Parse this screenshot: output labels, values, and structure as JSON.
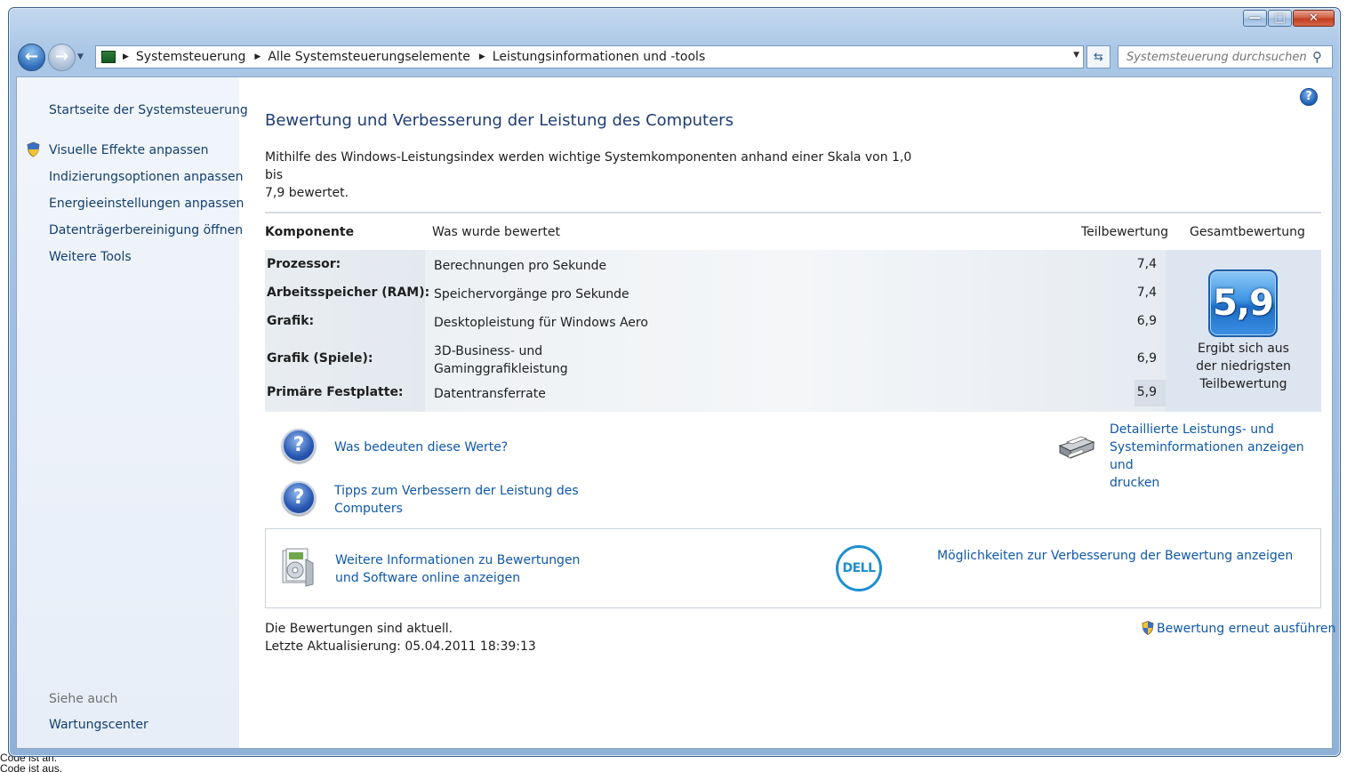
{
  "window": {
    "caption_buttons": [
      "minimize",
      "maximize",
      "close"
    ]
  },
  "nav": {
    "breadcrumbs": [
      "Systemsteuerung",
      "Alle Systemsteuerungselemente",
      "Leistungsinformationen und -tools"
    ],
    "search_placeholder": "Systemsteuerung durchsuchen"
  },
  "sidebar": {
    "items": [
      {
        "label": "Startseite der Systemsteuerung"
      },
      {
        "label": "Visuelle Effekte anpassen"
      },
      {
        "label": "Indizierungsoptionen anpassen"
      },
      {
        "label": "Energieeinstellungen anpassen"
      },
      {
        "label": "Datenträgerbereinigung öffnen"
      },
      {
        "label": "Weitere Tools"
      }
    ],
    "see_also_label": "Siehe auch",
    "see_also_items": [
      {
        "label": "Wartungscenter"
      }
    ]
  },
  "main": {
    "title": "Bewertung und Verbesserung der Leistung des Computers",
    "intro_line1": "Mithilfe des Windows-Leistungsindex werden wichtige Systemkomponenten anhand einer Skala von 1,0 bis",
    "intro_line2": "7,9 bewertet.",
    "table": {
      "headers": {
        "component": "Komponente",
        "rated": "Was wurde bewertet",
        "subscore": "Teilbewertung",
        "basescore": "Gesamtbewertung"
      },
      "rows": [
        {
          "component": "Prozessor:",
          "what": "Berechnungen pro Sekunde",
          "what2": "",
          "score": "7,4"
        },
        {
          "component": "Arbeitsspeicher (RAM):",
          "what": "Speichervorgänge pro Sekunde",
          "what2": "",
          "score": "7,4"
        },
        {
          "component": "Grafik:",
          "what": "Desktopleistung für Windows Aero",
          "what2": "",
          "score": "6,9"
        },
        {
          "component": "Grafik (Spiele):",
          "what": "3D-Business- und",
          "what2": "Gaminggrafikleistung",
          "score": "6,9"
        },
        {
          "component": "Primäre Festplatte:",
          "what": "Datentransferrate",
          "what2": "",
          "score": "5,9"
        }
      ],
      "base_score": "5,9",
      "base_note_line1": "Ergibt sich aus",
      "base_note_line2": "der niedrigsten",
      "base_note_line3": "Teilbewertung"
    },
    "links": {
      "what_mean": "Was bedeuten diese Werte?",
      "tips_line1": "Tipps zum Verbessern der Leistung des",
      "tips_line2": "Computers",
      "details_line1": "Detaillierte Leistungs- und",
      "details_line2": "Systeminformationen anzeigen und",
      "details_line3": "drucken",
      "more_info_line1": "Weitere Informationen zu Bewertungen",
      "more_info_line2": "und Software online anzeigen",
      "improve": "Möglichkeiten zur Verbesserung der Bewertung anzeigen",
      "rerun": "Bewertung erneut ausführen"
    },
    "dell_logo_text": "DELL",
    "status_line1": "Die Bewertungen sind aktuell.",
    "status_line2": "Letzte Aktualisierung: 05.04.2011 18:39:13"
  },
  "background": {
    "line1": "Code ist an.",
    "line2": "Code ist aus."
  },
  "colors": {
    "link": "#0f58a8",
    "title": "#1e3d73",
    "sidebar_bg": "#e7eef8",
    "frame": "#9cbde2"
  },
  "icons": [
    "back-arrow-icon",
    "forward-arrow-icon",
    "control-panel-icon",
    "refresh-icon",
    "search-icon",
    "help-icon",
    "shield-icon",
    "question-icon",
    "printer-icon",
    "software-box-icon",
    "dell-logo"
  ]
}
